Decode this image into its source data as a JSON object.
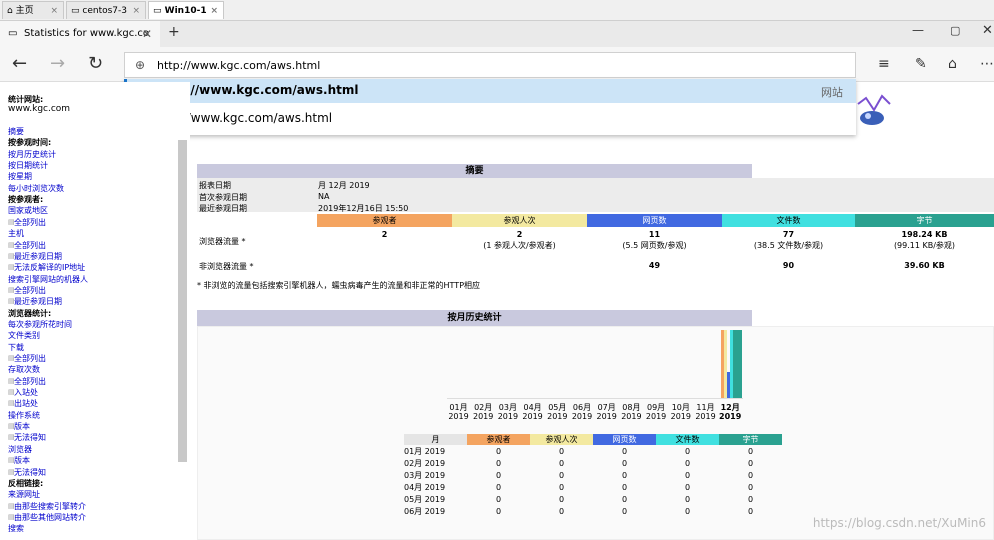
{
  "vm_tabs": [
    {
      "label": "主页",
      "icon": "home-icon"
    },
    {
      "label": "centos7-3",
      "icon": "vm-icon"
    },
    {
      "label": "Win10-1",
      "icon": "vm-icon"
    }
  ],
  "browser": {
    "tab_title": "Statistics for www.kgc.co",
    "address_value": "http://www.kgc.com/aws.html",
    "suggestion_top": "http://www.kgc.com/aws.html",
    "suggestion_tag": "网站",
    "suggestion_search": "http://www.kgc.com/aws.html",
    "watermark": "https://blog.csdn.net/XuMin6"
  },
  "left_menu": {
    "site_label": "统计网站:",
    "site_value": "www.kgc.com",
    "items": [
      {
        "text": "摘要",
        "type": "link"
      },
      {
        "text": "按参观时间:",
        "type": "head"
      },
      {
        "text": "按月历史统计",
        "type": "link"
      },
      {
        "text": "按日期统计",
        "type": "link"
      },
      {
        "text": "按星期",
        "type": "link"
      },
      {
        "text": "每小时浏览次数",
        "type": "link"
      },
      {
        "text": "按参观者:",
        "type": "head"
      },
      {
        "text": "国家或地区",
        "type": "link"
      },
      {
        "text": "全部列出",
        "type": "sub"
      },
      {
        "text": "主机",
        "type": "link"
      },
      {
        "text": "全部列出",
        "type": "sub"
      },
      {
        "text": "最近参观日期",
        "type": "sub"
      },
      {
        "text": "无法反解译的IP地址",
        "type": "sub"
      },
      {
        "text": "搜索引擎网站的机器人",
        "type": "link"
      },
      {
        "text": "全部列出",
        "type": "sub"
      },
      {
        "text": "最近参观日期",
        "type": "sub"
      },
      {
        "text": "浏览器统计:",
        "type": "head"
      },
      {
        "text": "每次参观所花时间",
        "type": "link"
      },
      {
        "text": "文件类别",
        "type": "link"
      },
      {
        "text": "下载",
        "type": "link"
      },
      {
        "text": "全部列出",
        "type": "sub"
      },
      {
        "text": "存取次数",
        "type": "link"
      },
      {
        "text": "全部列出",
        "type": "sub"
      },
      {
        "text": "入站处",
        "type": "sub"
      },
      {
        "text": "出站处",
        "type": "sub"
      },
      {
        "text": "操作系统",
        "type": "link"
      },
      {
        "text": "版本",
        "type": "sub"
      },
      {
        "text": "无法得知",
        "type": "sub"
      },
      {
        "text": "浏览器",
        "type": "link"
      },
      {
        "text": "版本",
        "type": "sub"
      },
      {
        "text": "无法得知",
        "type": "sub"
      },
      {
        "text": "反相链接:",
        "type": "head"
      },
      {
        "text": "来源网址",
        "type": "link"
      },
      {
        "text": "由那些搜索引擎转介",
        "type": "sub"
      },
      {
        "text": "由那些其他网站转介",
        "type": "sub"
      },
      {
        "text": "搜索",
        "type": "link"
      }
    ]
  },
  "summary": {
    "section_title": "摘要",
    "rows": [
      {
        "label": "报表日期",
        "value": "月 12月 2019"
      },
      {
        "label": "首次参观日期",
        "value": "NA"
      },
      {
        "label": "最近参观日期",
        "value": "2019年12月16日 15:50"
      }
    ],
    "columns": [
      "参观者",
      "参观人次",
      "网页数",
      "文件数",
      "字节"
    ],
    "browser_row": {
      "label": "浏览器流量 *",
      "visitors": "2",
      "visits": "2",
      "visits_sub": "(1 参观人次/参观者)",
      "pages": "11",
      "pages_sub": "(5.5 网页数/参观)",
      "hits": "77",
      "hits_sub": "(38.5 文件数/参观)",
      "bytes": "198.24 KB",
      "bytes_sub": "(99.11 KB/参观)"
    },
    "nonbrowser_row": {
      "label": "非浏览器流量 *",
      "pages": "49",
      "hits": "90",
      "bytes": "39.60 KB"
    },
    "footnote": "* 非浏览的流量包括搜索引擎机器人，蠕虫病毒产生的流量和非正常的HTTP相应"
  },
  "monthly": {
    "section_title": "按月历史统计",
    "months": [
      "01月",
      "02月",
      "03月",
      "04月",
      "05月",
      "06月",
      "07月",
      "08月",
      "09月",
      "10月",
      "11月",
      "12月"
    ],
    "years": [
      "2019",
      "2019",
      "2019",
      "2019",
      "2019",
      "2019",
      "2019",
      "2019",
      "2019",
      "2019",
      "2019",
      "2019"
    ],
    "table_headers": [
      "月",
      "参观者",
      "参观人次",
      "网页数",
      "文件数",
      "字节"
    ],
    "table_rows": [
      [
        "01月 2019",
        "0",
        "0",
        "0",
        "0",
        "0"
      ],
      [
        "02月 2019",
        "0",
        "0",
        "0",
        "0",
        "0"
      ],
      [
        "03月 2019",
        "0",
        "0",
        "0",
        "0",
        "0"
      ],
      [
        "04月 2019",
        "0",
        "0",
        "0",
        "0",
        "0"
      ],
      [
        "05月 2019",
        "0",
        "0",
        "0",
        "0",
        "0"
      ],
      [
        "06月 2019",
        "0",
        "0",
        "0",
        "0",
        "0"
      ]
    ]
  },
  "colors": {
    "visitors": "#f4a460",
    "visits": "#f3e9a0",
    "pages": "#4169e1",
    "hits": "#40e0e0",
    "bytes": "#2aa190",
    "section_bar": "#c9c9de"
  }
}
